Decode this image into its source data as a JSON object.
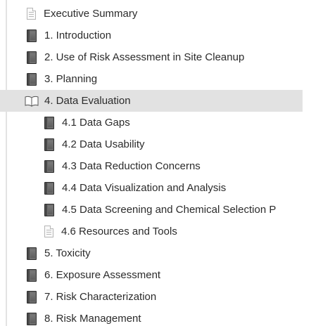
{
  "toc": {
    "items": [
      {
        "label": "Executive Summary",
        "icon": "document-icon",
        "level": 1
      },
      {
        "label": "1. Introduction",
        "icon": "book-icon",
        "level": 1
      },
      {
        "label": "2. Use of Risk Assessment in Site Cleanup",
        "icon": "book-icon",
        "level": 1
      },
      {
        "label": "3. Planning",
        "icon": "book-icon",
        "level": 1
      },
      {
        "label": "4. Data Evaluation",
        "icon": "open-book-icon",
        "level": 1,
        "selected": true
      },
      {
        "label": "4.1 Data Gaps",
        "icon": "book-icon",
        "level": 2
      },
      {
        "label": "4.2 Data Usability",
        "icon": "book-icon",
        "level": 2
      },
      {
        "label": "4.3 Data Reduction Concerns",
        "icon": "book-icon",
        "level": 2
      },
      {
        "label": "4.4 Data Visualization and Analysis",
        "icon": "book-icon",
        "level": 2
      },
      {
        "label": "4.5 Data Screening and Chemical Selection P",
        "icon": "book-icon",
        "level": 2
      },
      {
        "label": "4.6 Resources and Tools",
        "icon": "document-icon",
        "level": 2
      },
      {
        "label": "5. Toxicity",
        "icon": "book-icon",
        "level": 1
      },
      {
        "label": "6. Exposure Assessment",
        "icon": "book-icon",
        "level": 1
      },
      {
        "label": "7. Risk Characterization",
        "icon": "book-icon",
        "level": 1
      },
      {
        "label": "8. Risk Management",
        "icon": "book-icon",
        "level": 1
      }
    ]
  },
  "colors": {
    "selected_background": "#e2e2e2",
    "text": "#2b2b2b",
    "book_icon": "#5a5a5a"
  }
}
